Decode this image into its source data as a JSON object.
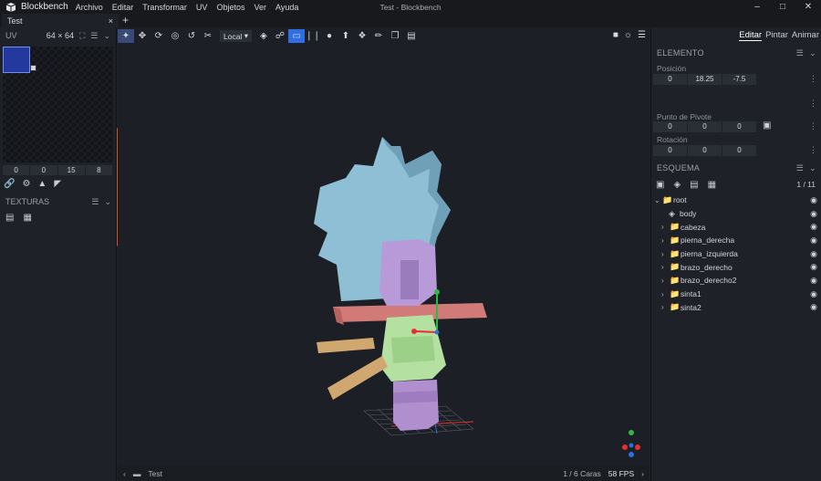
{
  "app": {
    "name": "Blockbench",
    "window_title": "Test - Blockbench"
  },
  "menu": [
    "Archivo",
    "Editar",
    "Transformar",
    "UV",
    "Objetos",
    "Ver",
    "Ayuda"
  ],
  "tab": {
    "label": "Test",
    "close": "×",
    "new": "+"
  },
  "uv_panel": {
    "title": "UV",
    "size": "64 × 64",
    "values": [
      "0",
      "0",
      "15",
      "8"
    ]
  },
  "textures_panel": {
    "title": "TEXTURAS"
  },
  "toolbar": {
    "space_select": "Local"
  },
  "modes": [
    "Editar",
    "Pintar",
    "Animar"
  ],
  "element": {
    "title": "ELEMENTO",
    "position_label": "Posición",
    "position": [
      "0",
      "18.25",
      "-7.5"
    ],
    "pivot_label": "Punto de Pivote",
    "pivot": [
      "0",
      "0",
      "0"
    ],
    "rotation_label": "Rotación",
    "rotation": [
      "0",
      "0",
      "0"
    ]
  },
  "outliner": {
    "title": "ESQUEMA",
    "count": "1 / 11",
    "items": [
      {
        "label": "root",
        "type": "folder",
        "depth": 0,
        "expanded": true
      },
      {
        "label": "body",
        "type": "locator",
        "depth": 1
      },
      {
        "label": "cabeza",
        "type": "folder",
        "depth": 1
      },
      {
        "label": "pierna_derecha",
        "type": "folder",
        "depth": 1
      },
      {
        "label": "pierna_izquierda",
        "type": "folder",
        "depth": 1
      },
      {
        "label": "brazo_derecho",
        "type": "folder",
        "depth": 1
      },
      {
        "label": "brazo_derecho2",
        "type": "folder",
        "depth": 1
      },
      {
        "label": "sinta1",
        "type": "folder",
        "depth": 1
      },
      {
        "label": "sinta2",
        "type": "folder",
        "depth": 1
      }
    ]
  },
  "status": {
    "model": "Test",
    "faces": "1 / 6 Caras",
    "fps": "58 FPS"
  },
  "colors": {
    "accent": "#2f6ee3",
    "bg": "#1e2127",
    "viewport": "#1c1f25"
  }
}
